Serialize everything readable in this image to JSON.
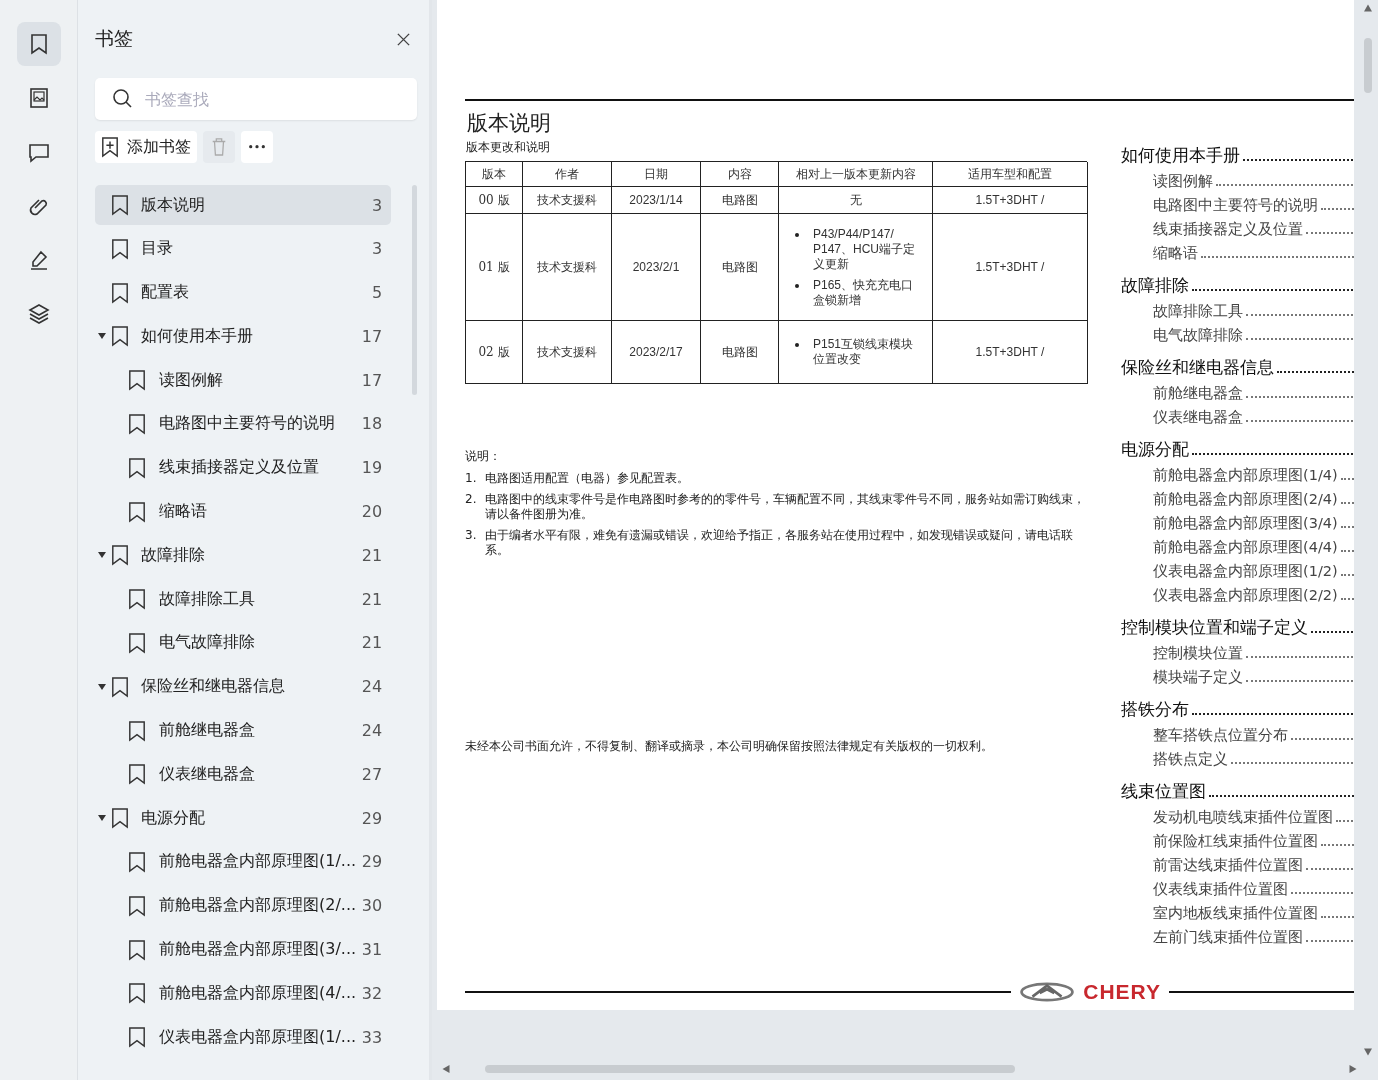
{
  "rail": [
    {
      "selected": true
    },
    {
      "selected": false
    },
    {
      "selected": false
    },
    {
      "selected": false
    },
    {
      "selected": false
    },
    {
      "selected": false
    }
  ],
  "panel": {
    "title": "书签",
    "search_placeholder": "书签查找",
    "add_label": "添加书签"
  },
  "bookmarks": [
    {
      "label": "版本说明",
      "page": "3",
      "selected": true
    },
    {
      "label": "目录",
      "page": "3",
      "selected": false
    },
    {
      "label": "配置表",
      "page": "5",
      "selected": false
    },
    {
      "label": "如何使用本手册",
      "page": "17",
      "selected": false,
      "expanded": true,
      "children": [
        {
          "label": "读图例解",
          "page": "17",
          "selected": false
        },
        {
          "label": "电路图中主要符号的说明",
          "page": "18",
          "selected": false
        },
        {
          "label": "线束插接器定义及位置",
          "page": "19",
          "selected": false
        },
        {
          "label": "缩略语",
          "page": "20",
          "selected": false
        }
      ]
    },
    {
      "label": "故障排除",
      "page": "21",
      "selected": false,
      "expanded": true,
      "children": [
        {
          "label": "故障排除工具",
          "page": "21",
          "selected": false
        },
        {
          "label": "电气故障排除",
          "page": "21",
          "selected": false
        }
      ]
    },
    {
      "label": "保险丝和继电器信息",
      "page": "24",
      "selected": false,
      "expanded": true,
      "children": [
        {
          "label": "前舱继电器盒",
          "page": "24",
          "selected": false
        },
        {
          "label": "仪表继电器盒",
          "page": "27",
          "selected": false
        }
      ]
    },
    {
      "label": "电源分配",
      "page": "29",
      "selected": false,
      "expanded": true,
      "children": [
        {
          "label": "前舱电器盒内部原理图(1/...",
          "page": "29",
          "selected": false
        },
        {
          "label": "前舱电器盒内部原理图(2/...",
          "page": "30",
          "selected": false
        },
        {
          "label": "前舱电器盒内部原理图(3/...",
          "page": "31",
          "selected": false
        },
        {
          "label": "前舱电器盒内部原理图(4/...",
          "page": "32",
          "selected": false
        },
        {
          "label": "仪表电器盒内部原理图(1/...",
          "page": "33",
          "selected": false
        }
      ]
    }
  ],
  "page": {
    "title": "版本说明",
    "subtitle": "版本更改和说明",
    "columns": [
      "版本",
      "作者",
      "日期",
      "内容",
      "相对上一版本更新内容",
      "适用车型和配置"
    ],
    "rows": [
      {
        "version": "00 版",
        "author": "技术支援科",
        "date": "2023/1/14",
        "content": "电路图",
        "changes_bulleted": false,
        "changes": [
          "无"
        ],
        "config": "1.5T+3DHT /"
      },
      {
        "version": "01 版",
        "author": "技术支援科",
        "date": "2023/2/1",
        "content": "电路图",
        "changes_bulleted": true,
        "changes": [
          "P43/P44/P147/ P147、HCU端子定义更新",
          "P165、快充充电口盒锁新增"
        ],
        "config": "1.5T+3DHT /"
      },
      {
        "version": "02 版",
        "author": "技术支援科",
        "date": "2023/2/17",
        "content": "电路图",
        "changes_bulleted": true,
        "changes": [
          "P151互锁线束模块位置改变"
        ],
        "config": "1.5T+3DHT /"
      }
    ],
    "notes_title": "说明：",
    "notes": [
      {
        "num": "1.",
        "text": "电路图适用配置（电器）参见配置表。"
      },
      {
        "num": "2.",
        "text": "电路图中的线束零件号是作电路图时参考的的零件号，车辆配置不同，其线束零件号不同，服务站如需订购线束，请以备件图册为准。"
      },
      {
        "num": "3.",
        "text": "由于编者水平有限，难免有遗漏或错误，欢迎给予指正，各服务站在使用过程中，如发现错误或疑问，请电话联系。"
      }
    ],
    "copyright": "未经本公司书面允许，不得复制、翻译或摘录，本公司明确保留按照法律规定有关版权的一切权利。",
    "brand": "CHERY",
    "toc": [
      {
        "title": "如何使用本手册",
        "items": [
          "读图例解",
          "电路图中主要符号的说明",
          "线束插接器定义及位置",
          "缩略语"
        ]
      },
      {
        "title": "故障排除",
        "items": [
          "故障排除工具",
          "电气故障排除"
        ]
      },
      {
        "title": "保险丝和继电器信息",
        "items": [
          "前舱继电器盒",
          "仪表继电器盒"
        ]
      },
      {
        "title": "电源分配",
        "items": [
          "前舱电器盒内部原理图(1/4)",
          "前舱电器盒内部原理图(2/4)",
          "前舱电器盒内部原理图(3/4)",
          "前舱电器盒内部原理图(4/4)",
          "仪表电器盒内部原理图(1/2)",
          "仪表电器盒内部原理图(2/2)"
        ]
      },
      {
        "title": "控制模块位置和端子定义",
        "items": [
          "控制模块位置",
          "模块端子定义"
        ]
      },
      {
        "title": "搭铁分布",
        "items": [
          "整车搭铁点位置分布",
          "搭铁点定义"
        ]
      },
      {
        "title": "线束位置图",
        "items": [
          "发动机电喷线束插件位置图",
          "前保险杠线束插件位置图",
          "前雷达线束插件位置图",
          "仪表线束插件位置图",
          "室内地板线束插件位置图",
          "左前门线束插件位置图"
        ]
      }
    ]
  }
}
